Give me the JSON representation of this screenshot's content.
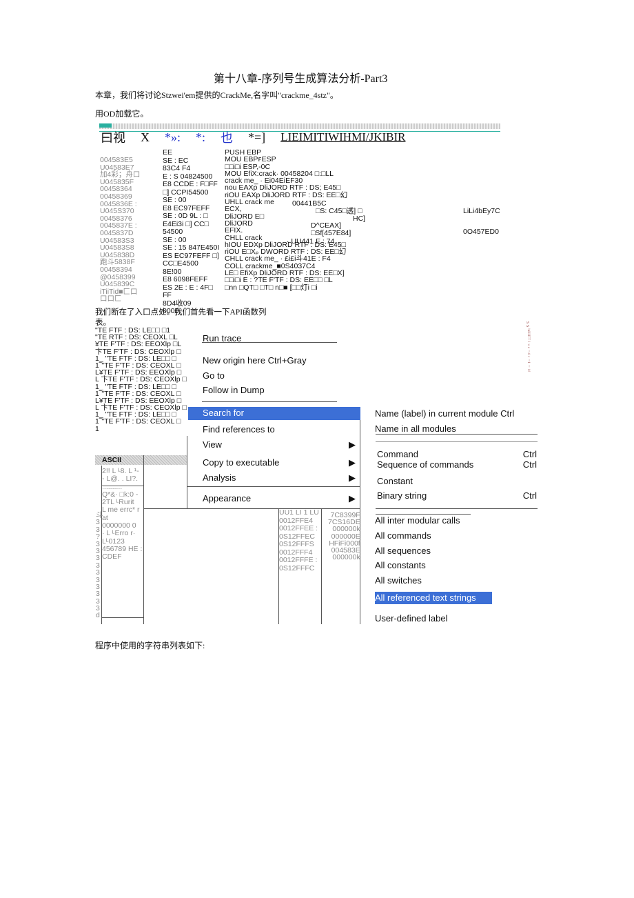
{
  "title": "第十八章-序列号生成算法分析-Part3",
  "intro": "本章，我们将讨论Stzwei'em提供的CrackMe,名字叫\"crackme_4stz\"。",
  "load_text": "用OD加载它。",
  "toolbar": {
    "items": [
      "曰视",
      "X",
      "*»:",
      "*:",
      "也",
      "*=]",
      "LIEIMITIWIHMI/JKIBIR"
    ]
  },
  "disasm": {
    "addresses": [
      "004583E5",
      "U04583E7",
      "加4彩；舟口",
      "U045835F",
      "00458364",
      "00458369",
      "0045836E :",
      "U045S370",
      "00458376",
      "0045837E :",
      "0045837D",
      "U04583S3",
      "U04583S8",
      "U045838D",
      "跑斗5838F",
      "00458394",
      "@0458399",
      "U045839C",
      "iTiiTid■匚口",
      "口口匚"
    ],
    "hex": [
      "EE",
      "SE : EC",
      "83C4 F4",
      "E : S 04824500",
      "E8 CCDE : F□FF",
      "□] CCPI54500",
      "SE : 00",
      "E8 EC97FEFF",
      "SE : 0D 9L : □",
      "E4Ei3i □] CC□",
      "54500",
      "SE : 00",
      "SE : 15 847E450I",
      "ES EC97FEFF □]",
      "CC□E4500",
      "8E!00",
      "E8 6098FEFF",
      "ES 2E : E : 4F□",
      "FF",
      "8D4收09",
      "0000"
    ],
    "instr": [
      "PUSH EBP",
      "MOU EBPꜰESP",
      "□□i□i ESP,-0C",
      "MOU EfiX:crack· 00458204 □:□LL",
      "crack me_ · Ei04EiEF30",
      "nou EAXp DliJORD RTF : DS; E45□",
      "riOU EAXp DliJORD RTF : DS: EE□幻",
      "UHLL crack me",
      "ECX,",
      "DliJORD E□",
      "DliJORD",
      "EFIX.",
      "CHLL crack",
      "hIOU EDXp DliJORD RTF : DS: E45□",
      "riOU E□Xₚ DWORD RTF : DS: EE□幻",
      "CHLL crack me_ · £i£i斗41E : F4",
      "COLL crackme_■0S4037C4",
      "LE□ EfiXp DliJORD RTF : DS: EE□X]",
      "□□i□i E : ?TE F'TF : DS: EE□□ □L",
      "□nn □QT□ □T□ n□■ [□□灯i □i"
    ],
    "extra": [
      "00441B5C",
      "□S: C45□透] □",
      "HC]",
      "D^CEAX]",
      "□Sf[457E84]",
      "· UU441 E : 74"
    ],
    "right": [
      "LiLi4bEy7C",
      "0O457ED0"
    ]
  },
  "mid_text": "我们断在了入口点处。我们首先看一下API函数列",
  "mid_text2": "表。",
  "api_list": [
    "\"TE FTF : DS: LE□□ □1",
    "\"TE RTF : DS: CEOXL □L",
    "¥TE F'TF : DS: EEOXlp □L",
    "卞TE F'TF : DS: CEOXlp □",
    "1_ \"TE FTF : DS: LE□□ □",
    "1‾\"TE F'TF : DS: CEOXL □",
    "L¥TE F'TF : DS: EEOXlp □",
    "L 卞TE F'TF : DS: CEOXlp □",
    "1_ \"TE FTF : DS: LE□□ □",
    "1‾\"TE F'TF : DS: CEOXL □",
    "L¥TE F'TF : DS: EEOXlp □",
    "L 卞TE F'TF : DS: CEOXlp □",
    "1_ \"TE FTF : DS: LE□□ □",
    "1‾\"TE F'TF : DS: CEOXL □",
    "1"
  ],
  "dump": {
    "header": "ASCII",
    "rows": [
      "2!! L ᴸ8. L ¹-",
      "- L@. . LI?.",
      "..........",
      "Q*&· □k:0 -",
      "2TL ᴸRurit",
      "L me errc* r",
      "at",
      "0000000 0",
      "· L ᴸErro r·",
      "Lᴸ0123",
      "456789 HE :",
      "CDEF"
    ],
    "left_col": [
      "斗",
      "3",
      "3",
      "?",
      "3",
      "3",
      "3",
      "3",
      "3",
      "3",
      "3",
      "3",
      "3",
      "3",
      "d"
    ]
  },
  "stack": {
    "addresses": [
      "UU1 LI 1 LU",
      "0012FFE4",
      "0012FFEE :",
      "0S12FFEC",
      "0S12FFFS",
      "0012FFF4",
      "0012FFFE :",
      "0S12FFFC"
    ],
    "values": [
      "7C8399F",
      "7CS16DE",
      "000000k",
      "000000E",
      "HFiFi000f",
      "004583E",
      "000000k"
    ]
  },
  "side_vertical": "s s ⁱⁿᴴᴴᵀᵀ ˡ ᵘ ᵉ ⁻⁴ ᶜ ⁻¹ ⁻ ¹ᶠ",
  "context_menu": {
    "items": [
      {
        "label": "Run trace"
      },
      {
        "label": "New origin here Ctrl+Gray"
      },
      {
        "label": "Go to"
      },
      {
        "label": "Follow in Dump"
      },
      {
        "label": "Search for",
        "selected": true
      },
      {
        "label": "Find references to"
      },
      {
        "label": "View",
        "arrow": "▶"
      },
      {
        "label": "Copy to executable",
        "arrow": "▶"
      },
      {
        "label": "Analysis",
        "arrow": "▶"
      },
      {
        "label": "Appearance",
        "arrow": "▶"
      }
    ]
  },
  "submenu": {
    "items": [
      {
        "label": "Name (label) in current module Ctrl"
      },
      {
        "label": "Name in all modules"
      },
      {
        "label": "Command",
        "shortcut": "Ctrl"
      },
      {
        "label": "Sequence of commands",
        "shortcut": "Ctrl"
      },
      {
        "label": "Constant"
      },
      {
        "label": "Binary string",
        "shortcut": "Ctrl"
      },
      {
        "label": "All inter modular calls"
      },
      {
        "label": "All commands"
      },
      {
        "label": "All sequences"
      },
      {
        "label": "All constants"
      },
      {
        "label": "All switches"
      },
      {
        "label": "All referenced text strings",
        "selected": true
      },
      {
        "label": "User-defined label"
      }
    ]
  },
  "footer_text": "程序中使用的字符串列表如下:",
  "colors": {
    "highlight": "#3c6fd6",
    "toolbar_blue": "#2233cc",
    "dump_header": "#c8c8c8"
  }
}
